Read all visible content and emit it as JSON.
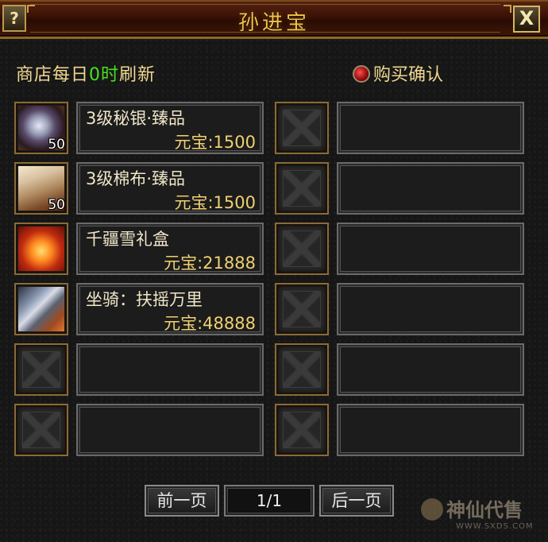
{
  "window": {
    "title": "孙进宝",
    "help_label": "?",
    "close_label": "X"
  },
  "header": {
    "refresh_prefix": "商店每日",
    "refresh_hour": "0时",
    "refresh_suffix": "刷新",
    "confirm_label": "购买确认"
  },
  "items": [
    {
      "name": "3级秘银·臻品",
      "price": "元宝:1500",
      "qty": "50",
      "icon": "mithril-ore-icon"
    },
    {
      "name": "3级棉布·臻品",
      "price": "元宝:1500",
      "qty": "50",
      "icon": "cotton-cloth-icon"
    },
    {
      "name": "千疆雪礼盒",
      "price": "元宝:21888",
      "qty": "",
      "icon": "gift-box-icon"
    },
    {
      "name": "坐骑：扶摇万里",
      "price": "元宝:48888",
      "qty": "",
      "icon": "mount-icon"
    }
  ],
  "pager": {
    "prev_label": "前一页",
    "page": "1/1",
    "next_label": "后一页"
  },
  "watermark": {
    "name": "神仙代售",
    "url": "WWW.SXDS.COM"
  }
}
